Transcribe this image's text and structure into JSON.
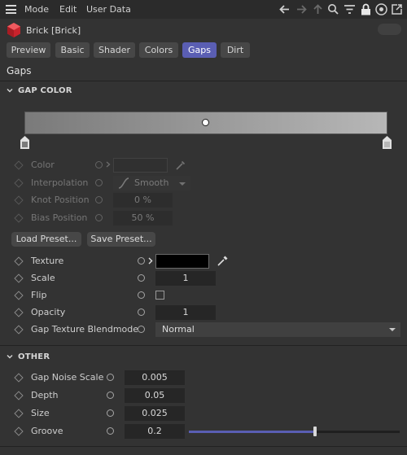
{
  "menubar": {
    "items": [
      "Mode",
      "Edit",
      "User Data"
    ]
  },
  "object": {
    "title": "Brick [Brick]",
    "icon": "red-cube-icon"
  },
  "tabs": [
    {
      "label": "Preview",
      "active": false
    },
    {
      "label": "Basic",
      "active": false
    },
    {
      "label": "Shader",
      "active": false
    },
    {
      "label": "Colors",
      "active": false
    },
    {
      "label": "Gaps",
      "active": true
    },
    {
      "label": "Dirt",
      "active": false
    }
  ],
  "section": {
    "title": "Gaps"
  },
  "gap_color": {
    "header": "GAP COLOR",
    "knot_position": 0.5,
    "color_label": "Color",
    "interpolation_label": "Interpolation",
    "interpolation_value": "Smooth",
    "knot_position_label": "Knot Position",
    "knot_position_value": "0 %",
    "bias_position_label": "Bias Position",
    "bias_position_value": "50 %",
    "load_preset": "Load Preset...",
    "save_preset": "Save Preset...",
    "texture_label": "Texture",
    "texture_color": "#000000",
    "scale_label": "Scale",
    "scale_value": "1",
    "flip_label": "Flip",
    "flip_checked": false,
    "opacity_label": "Opacity",
    "opacity_value": "1",
    "blendmode_label": "Gap Texture Blendmode",
    "blendmode_value": "Normal"
  },
  "other": {
    "header": "OTHER",
    "noise_scale_label": "Gap Noise Scale",
    "noise_scale_value": "0.005",
    "depth_label": "Depth",
    "depth_value": "0.05",
    "size_label": "Size",
    "size_value": "0.025",
    "groove_label": "Groove",
    "groove_value": "0.2",
    "groove_slider_fraction": 0.6
  },
  "colors": {
    "accent": "#5a5eb3",
    "background": "#333333"
  }
}
